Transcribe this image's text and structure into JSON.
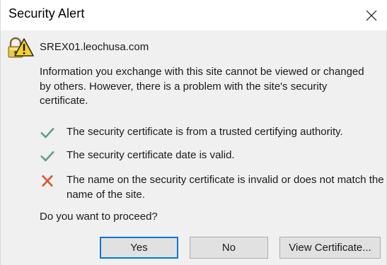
{
  "window": {
    "title": "Security Alert",
    "close_icon": "close-icon"
  },
  "site": {
    "host": "SREX01.leochusa.com",
    "icon": "lock-warning-icon"
  },
  "message": "Information you exchange with this site cannot be viewed or changed by others. However, there is a problem with the site's security certificate.",
  "checks": [
    {
      "status": "ok",
      "icon": "checkmark-icon",
      "color": "#5ba37f",
      "text": "The security certificate is from a trusted certifying authority."
    },
    {
      "status": "ok",
      "icon": "checkmark-icon",
      "color": "#5ba37f",
      "text": "The security certificate date is valid."
    },
    {
      "status": "error",
      "icon": "x-mark-icon",
      "color": "#d9552b",
      "text": "The name on the security certificate is invalid or does not match the name of the site."
    }
  ],
  "question": "Do you want to proceed?",
  "buttons": {
    "yes": "Yes",
    "no": "No",
    "view_certificate": "View Certificate..."
  },
  "colors": {
    "accent": "#0078d7",
    "ok": "#5ba37f",
    "error": "#d9552b",
    "titlebar": "#ffffff",
    "background": "#f0f0f0"
  }
}
